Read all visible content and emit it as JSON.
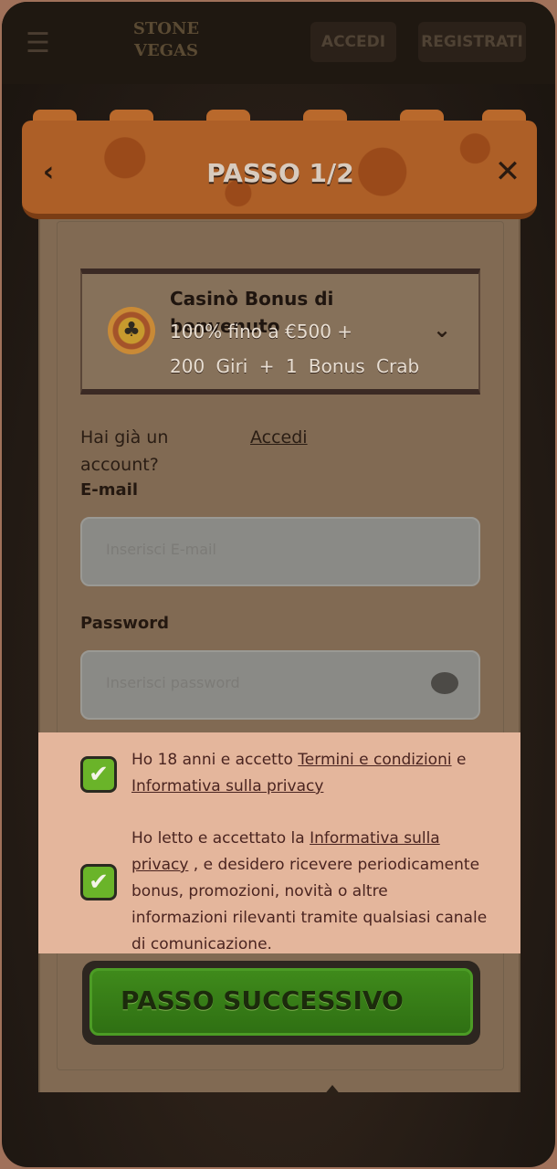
{
  "header": {
    "login_label": "ACCEDI",
    "register_label": "REGISTRATI",
    "logo_text": "STONE VEGAS"
  },
  "modal": {
    "step_title": "PASSO 1/2",
    "back_icon": "back-chevron-icon",
    "close_icon": "close-icon"
  },
  "bonus": {
    "title": "Casinò Bonus di benvenuto",
    "line1": "100% fino a €500 +",
    "line2": "200 Giri + 1 Bonus Crab",
    "icon": "casino-chip-icon"
  },
  "account": {
    "prompt": "Hai già un account?",
    "link": "Accedi"
  },
  "form": {
    "email_label": "E-mail",
    "email_placeholder": "Inserisci E-mail",
    "password_label": "Password",
    "password_placeholder": "Inserisci password"
  },
  "consents": {
    "c1_prefix": "Ho 18 anni e accetto ",
    "c1_link1": "Termini e condizioni",
    "c1_middle": " e ",
    "c1_link2": "Informativa sulla privacy",
    "c2_prefix": "Ho letto e accettato la ",
    "c2_link": "Informativa sulla privacy",
    "c2_suffix": " , e desidero ricevere periodicamente bonus, promozioni, novità o altre informazioni rilevanti tramite qualsiasi canale di comunicazione."
  },
  "actions": {
    "next_label": "PASSO SUCCESSIVO"
  },
  "colors": {
    "accent_green": "#3f8a1b",
    "awning_orange": "#ad5f27",
    "highlight": "#e4b69c"
  }
}
